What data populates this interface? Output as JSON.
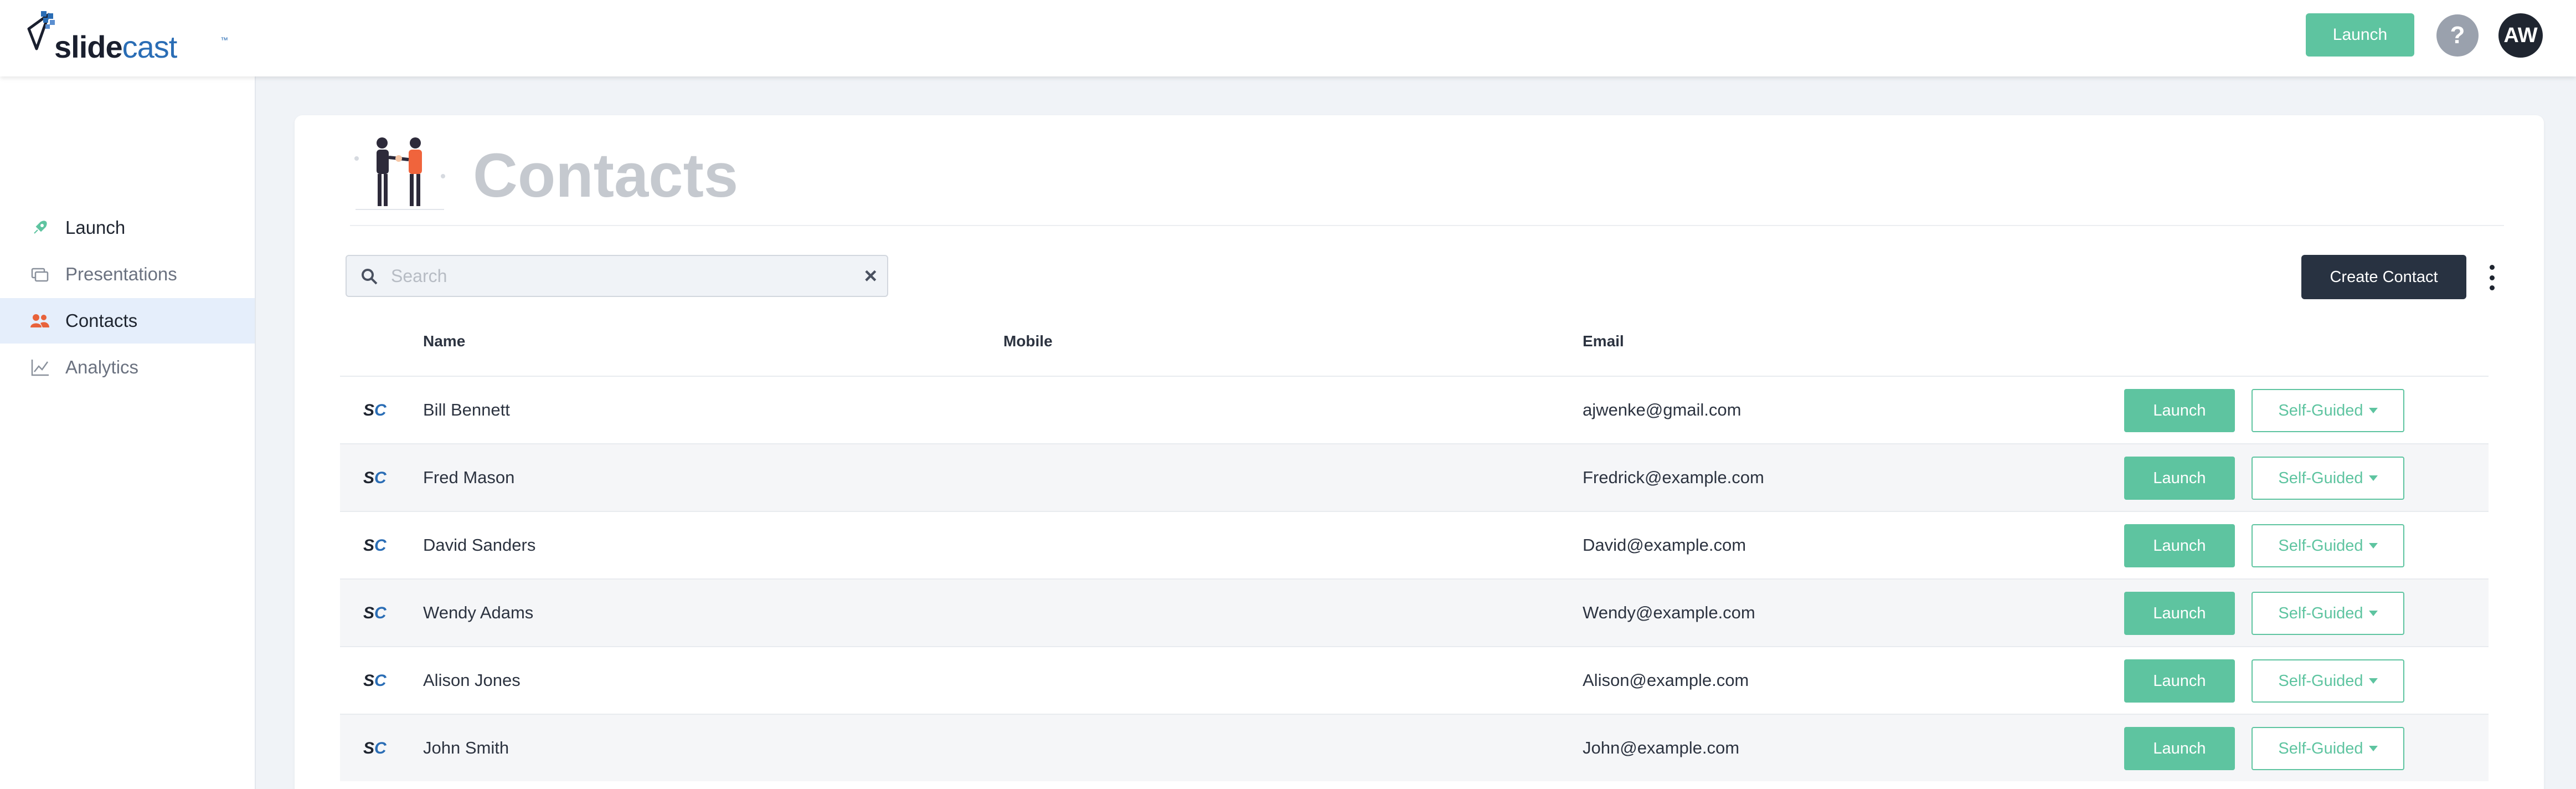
{
  "header": {
    "logo_text_a": "slide",
    "logo_text_b": "cast",
    "logo_tm": "™",
    "launch_label": "Launch",
    "help_label": "?",
    "avatar_initials": "AW"
  },
  "sidebar": {
    "items": [
      {
        "label": "Launch",
        "icon": "rocket-icon"
      },
      {
        "label": "Presentations",
        "icon": "slides-icon"
      },
      {
        "label": "Contacts",
        "icon": "people-icon",
        "active": true
      },
      {
        "label": "Analytics",
        "icon": "chart-icon"
      }
    ]
  },
  "main": {
    "title": "Contacts",
    "search": {
      "placeholder": "Search",
      "value": ""
    },
    "create_label": "Create Contact",
    "columns": {
      "name": "Name",
      "mobile": "Mobile",
      "email": "Email"
    },
    "rows": [
      {
        "badge_s": "S",
        "badge_c": "C",
        "name": "Bill Bennett",
        "mobile": "",
        "email": "ajwenke@gmail.com",
        "launch": "Launch",
        "mode": "Self-Guided"
      },
      {
        "badge_s": "S",
        "badge_c": "C",
        "name": "Fred Mason",
        "mobile": "",
        "email": "Fredrick@example.com",
        "launch": "Launch",
        "mode": "Self-Guided"
      },
      {
        "badge_s": "S",
        "badge_c": "C",
        "name": "David Sanders",
        "mobile": "",
        "email": "David@example.com",
        "launch": "Launch",
        "mode": "Self-Guided"
      },
      {
        "badge_s": "S",
        "badge_c": "C",
        "name": "Wendy Adams",
        "mobile": "",
        "email": "Wendy@example.com",
        "launch": "Launch",
        "mode": "Self-Guided"
      },
      {
        "badge_s": "S",
        "badge_c": "C",
        "name": "Alison Jones",
        "mobile": "",
        "email": "Alison@example.com",
        "launch": "Launch",
        "mode": "Self-Guided"
      },
      {
        "badge_s": "S",
        "badge_c": "C",
        "name": "John Smith",
        "mobile": "",
        "email": "John@example.com",
        "launch": "Launch",
        "mode": "Self-Guided"
      }
    ]
  },
  "colors": {
    "accent_green": "#5ec4a0",
    "dark": "#283241",
    "brand_blue": "#2a6db5",
    "active_bg": "#e5eefb"
  }
}
